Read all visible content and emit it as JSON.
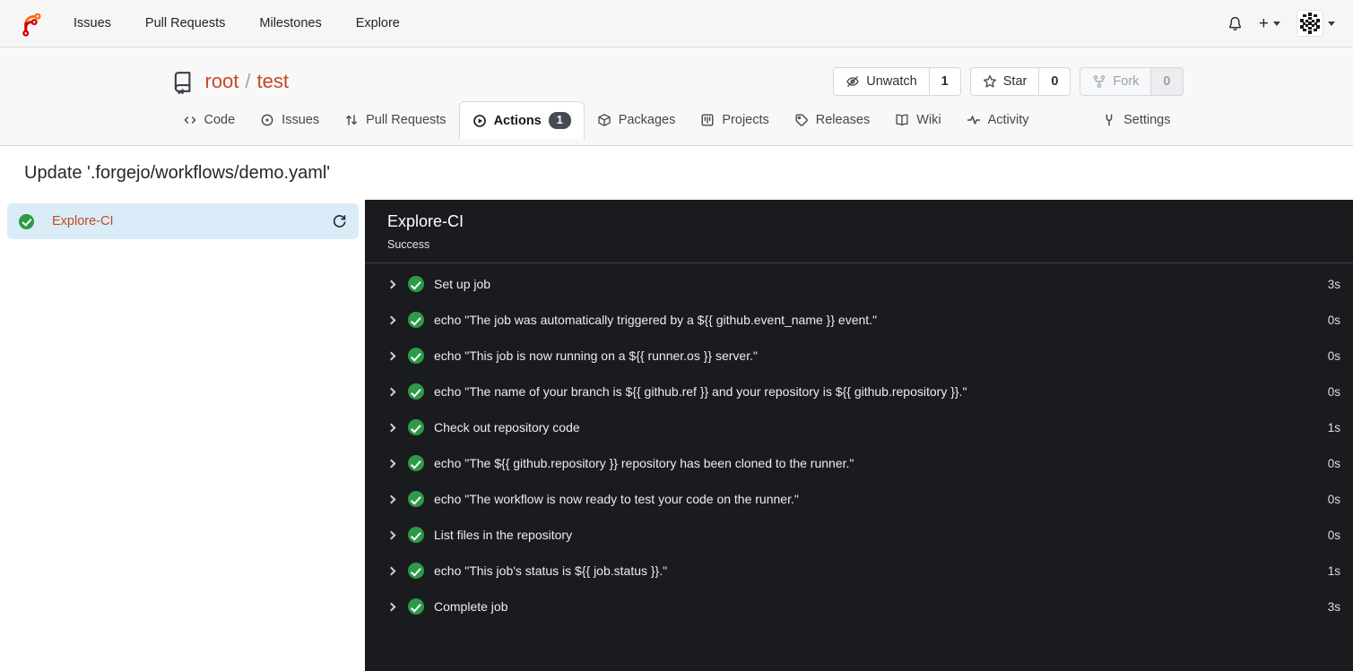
{
  "navbar": {
    "links": {
      "issues": "Issues",
      "pulls": "Pull Requests",
      "milestones": "Milestones",
      "explore": "Explore"
    },
    "plus": "+"
  },
  "repo_header": {
    "owner": "root",
    "separator": "/",
    "name": "test",
    "unwatch": {
      "label": "Unwatch",
      "count": "1"
    },
    "star": {
      "label": "Star",
      "count": "0"
    },
    "fork": {
      "label": "Fork",
      "count": "0"
    }
  },
  "tabs": {
    "code": "Code",
    "issues": "Issues",
    "pulls": "Pull Requests",
    "actions": "Actions",
    "actions_badge": "1",
    "packages": "Packages",
    "projects": "Projects",
    "releases": "Releases",
    "wiki": "Wiki",
    "activity": "Activity",
    "settings": "Settings"
  },
  "page": {
    "title": "Update '.forgejo/workflows/demo.yaml'"
  },
  "sidebar": {
    "job_label": "Explore-CI"
  },
  "run_panel": {
    "title": "Explore-CI",
    "status": "Success",
    "steps": [
      {
        "label": "Set up job",
        "duration": "3s"
      },
      {
        "label": "echo \"The job was automatically triggered by a ${{ github.event_name }} event.\"",
        "duration": "0s"
      },
      {
        "label": "echo \"This job is now running on a ${{ runner.os }} server.\"",
        "duration": "0s"
      },
      {
        "label": "echo \"The name of your branch is ${{ github.ref }} and your repository is ${{ github.repository }}.\"",
        "duration": "0s"
      },
      {
        "label": "Check out repository code",
        "duration": "1s"
      },
      {
        "label": "echo \"The ${{ github.repository }} repository has been cloned to the runner.\"",
        "duration": "0s"
      },
      {
        "label": "echo \"The workflow is now ready to test your code on the runner.\"",
        "duration": "0s"
      },
      {
        "label": "List files in the repository",
        "duration": "0s"
      },
      {
        "label": "echo \"This job's status is ${{ job.status }}.\"",
        "duration": "1s"
      },
      {
        "label": "Complete job",
        "duration": "3s"
      }
    ]
  },
  "colors": {
    "primary_link": "#c6491f",
    "success_green": "#2c9a47",
    "run_panel_bg": "#1a1b1e",
    "selected_job_bg": "#d9ecf8",
    "badge_bg": "#454a54"
  }
}
